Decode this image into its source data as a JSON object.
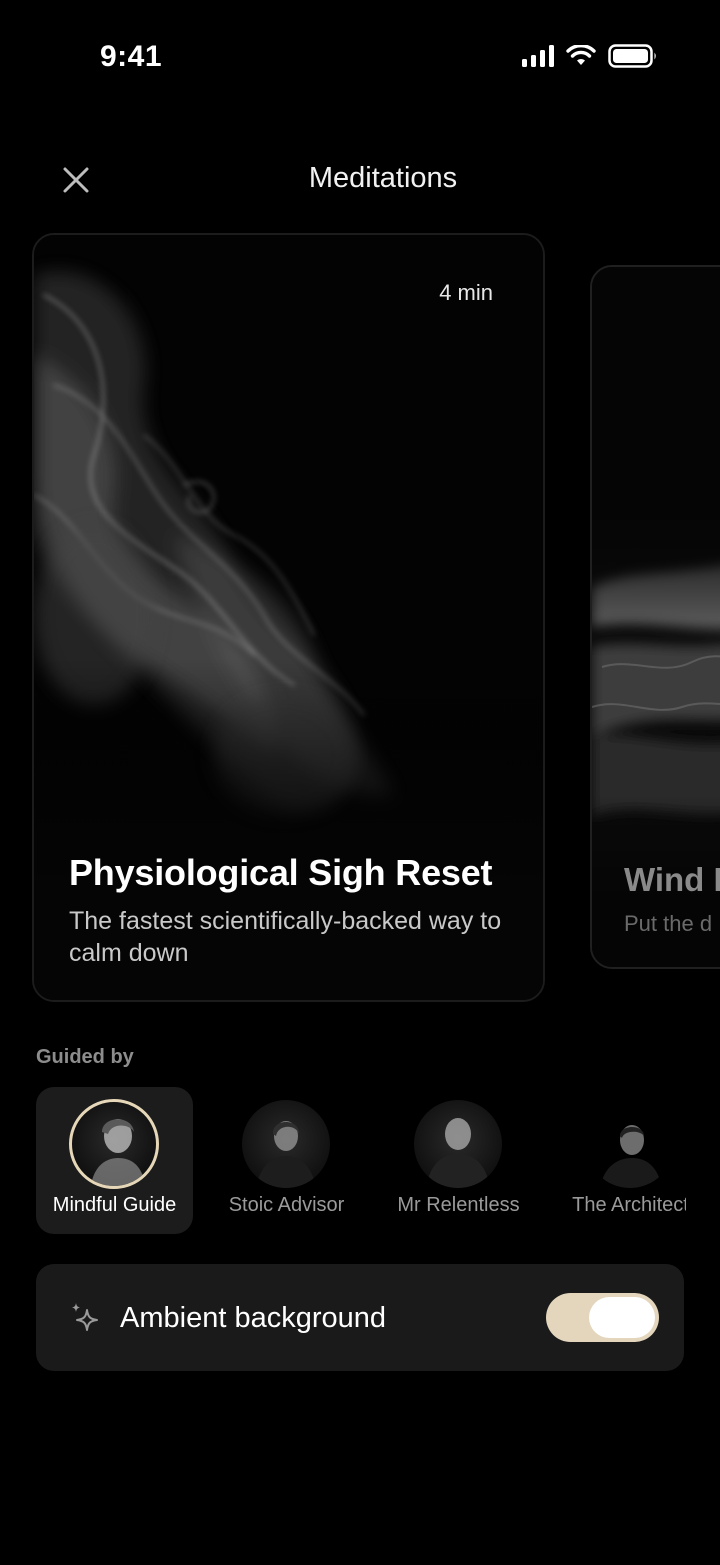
{
  "status_bar": {
    "time": "9:41"
  },
  "header": {
    "title": "Meditations"
  },
  "cards": [
    {
      "duration": "4 min",
      "title": "Physiological Sigh Reset",
      "subtitle": "The fastest scientifically-backed way to calm down"
    },
    {
      "title": "Wind D",
      "subtitle": "Put the d"
    }
  ],
  "guided": {
    "label": "Guided by",
    "guides": [
      {
        "name": "Mindful Guide",
        "selected": true
      },
      {
        "name": "Stoic Advisor",
        "selected": false
      },
      {
        "name": "Mr Relentless",
        "selected": false
      },
      {
        "name": "The Architect",
        "selected": false
      }
    ]
  },
  "ambient": {
    "label": "Ambient background",
    "enabled": true
  },
  "colors": {
    "accent": "#e3d6bd",
    "background": "#000000",
    "surface": "#1a1a1a"
  },
  "icons": [
    "close-icon",
    "sparkle-icon",
    "signal-icon",
    "wifi-icon",
    "battery-icon"
  ]
}
